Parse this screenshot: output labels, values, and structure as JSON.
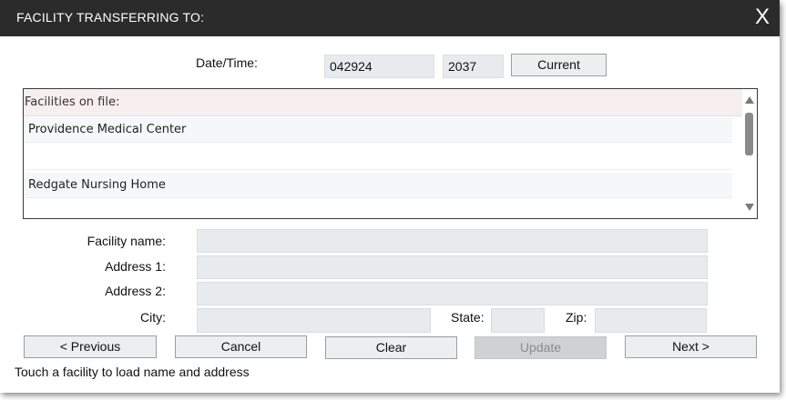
{
  "dialog": {
    "title": "FACILITY TRANSFERRING TO:",
    "close_glyph": "X"
  },
  "datetime": {
    "label": "Date/Time:",
    "date_value": "042924",
    "time_value": "2037",
    "current_label": "Current"
  },
  "facilities": {
    "header": "Facilities on file:",
    "items": [
      {
        "label": "Providence Medical Center"
      },
      {
        "label": ""
      },
      {
        "label": "Redgate Nursing Home"
      }
    ]
  },
  "form": {
    "facility_name_label": "Facility name:",
    "facility_name_value": "",
    "address1_label": "Address 1:",
    "address1_value": "",
    "address2_label": "Address 2:",
    "address2_value": "",
    "city_label": "City:",
    "city_value": "",
    "state_label": "State:",
    "state_value": "",
    "zip_label": "Zip:",
    "zip_value": ""
  },
  "buttons": {
    "previous": "< Previous",
    "cancel": "Cancel",
    "clear": "Clear",
    "update": "Update",
    "next": "Next >"
  },
  "status": {
    "message": "Touch a facility to load name and address"
  },
  "colors": {
    "titlebar": "#2b2b2b",
    "field_bg": "#e8ebee",
    "list_header_bg": "#f7eef0",
    "disabled_button_bg": "#cfd1d3"
  }
}
